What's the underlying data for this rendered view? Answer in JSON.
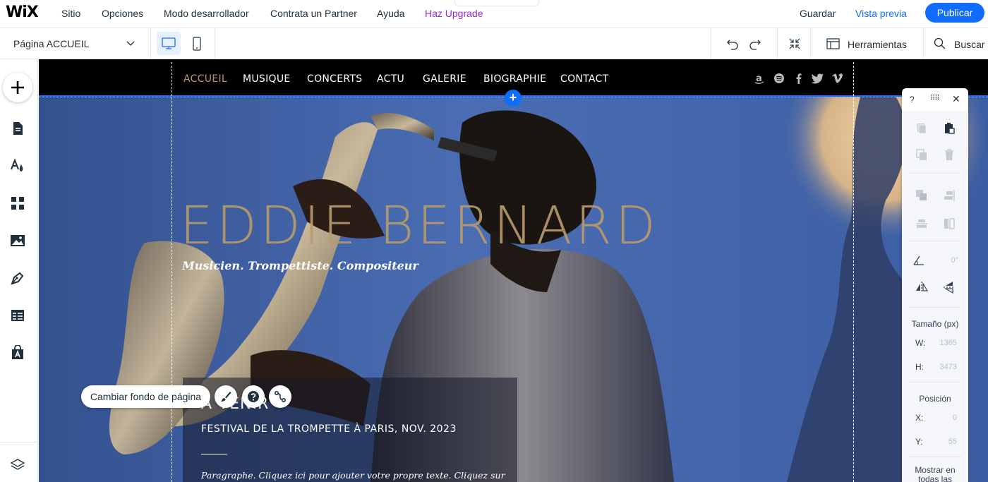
{
  "topbar": {
    "logo": "WiX",
    "menu": [
      "Sitio",
      "Opciones",
      "Modo desarrollador",
      "Contrata un Partner",
      "Ayuda"
    ],
    "upgrade": "Haz Upgrade",
    "handle": "⌃",
    "save": "Guardar",
    "preview": "Vista previa",
    "publish": "Publicar"
  },
  "subbar": {
    "page_label": "Página ACCUEIL",
    "tools_label": "Herramientas",
    "search_label": "Buscar"
  },
  "site": {
    "nav": [
      "ACCUEIL",
      "MUSIQUE",
      "CONCERTS",
      "ACTU",
      "GALERIE",
      "BIOGRAPHIE",
      "CONTACT"
    ],
    "social_icons": [
      "amazon-icon",
      "spotify-icon",
      "facebook-icon",
      "twitter-icon",
      "vimeo-icon"
    ],
    "title": "EDDIE BERNARD",
    "subtitle": "Musicien. Trompettiste. Compositeur",
    "upcoming_title": "À VENIR",
    "upcoming_event": "FESTIVAL DE LA TROMPETTE À PARIS, NOV. 2023",
    "upcoming_paragraph": "Paragraphe. Cliquez ici pour ajouter votre propre texte. Cliquez sur"
  },
  "canvas_actions": {
    "change_bg": "Cambiar fondo de página"
  },
  "tool_panel": {
    "help": "?",
    "drag": "⠿⠿",
    "close": "✕",
    "rotation": "0°",
    "size_title": "Tamaño (px)",
    "w_key": "W:",
    "w_val": "1365",
    "h_key": "H:",
    "h_val": "3473",
    "pos_title": "Posición",
    "x_key": "X:",
    "x_val": "0",
    "y_key": "Y:",
    "y_val": "55",
    "show_all": "Mostrar en todas las"
  },
  "colors": {
    "accent": "#116dff",
    "upgrade": "#9a27d5",
    "gold": "#b89a6c"
  }
}
